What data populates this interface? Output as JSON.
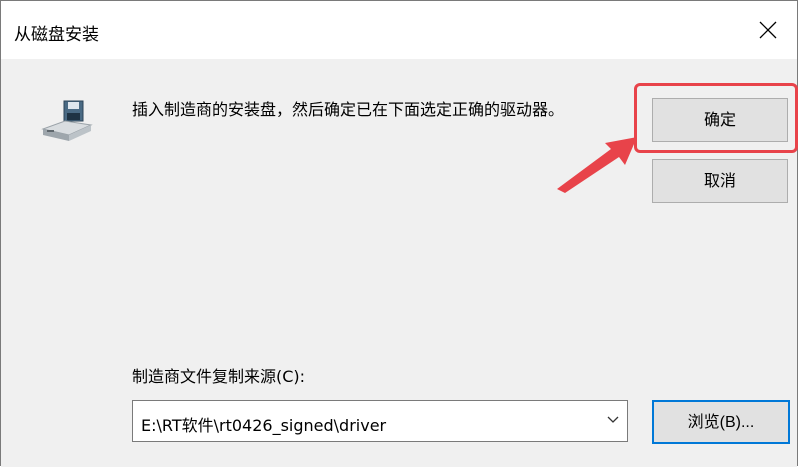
{
  "window": {
    "title": "从磁盘安装"
  },
  "dialog": {
    "message": "插入制造商的安装盘，然后确定已在下面选定正确的驱动器。",
    "ok_label": "确定",
    "cancel_label": "取消",
    "source_label": "制造商文件复制来源(C):",
    "source_value": "E:\\RT软件\\rt0426_signed\\driver",
    "browse_label": "浏览(B)..."
  },
  "icons": {
    "disk": "floppy-drive-icon",
    "close": "close-icon",
    "dropdown": "chevron-down-icon",
    "annotation": "red-arrow-icon"
  },
  "colors": {
    "highlight": "#e8434a",
    "focus_border": "#0078d7",
    "dialog_bg": "#f0f0f0",
    "button_bg": "#e1e1e1"
  }
}
